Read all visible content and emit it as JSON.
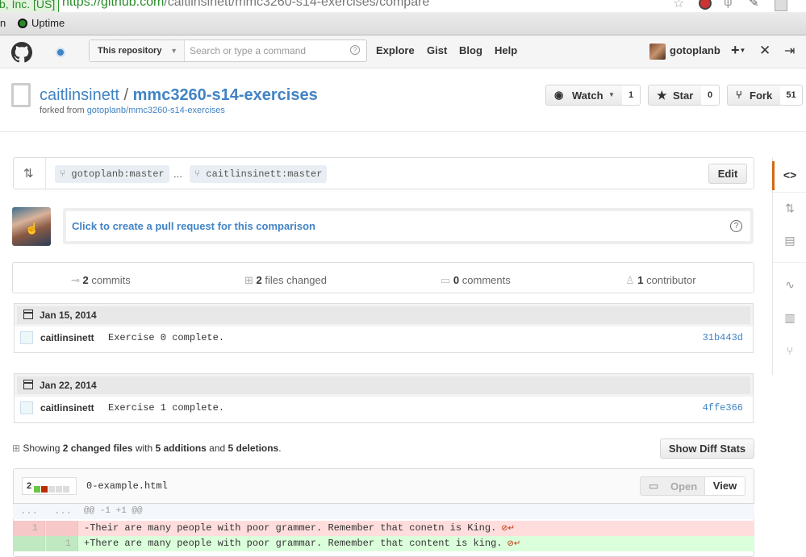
{
  "browser": {
    "ev_badge": "b, Inc. [US]",
    "url_host": "https://github.com",
    "url_path": "/caitlinsinett/mmc3260-s14-exercises/compare",
    "bookmarks": [
      "n",
      "Uptime"
    ]
  },
  "header": {
    "scope_label": "This repository",
    "search_placeholder": "Search or type a command",
    "nav": [
      "Explore",
      "Gist",
      "Blog",
      "Help"
    ],
    "username": "gotoplanb",
    "plus": "+"
  },
  "repo": {
    "owner": "caitlinsinett",
    "separator": "/",
    "name": "mmc3260-s14-exercises",
    "forked_prefix": "forked from ",
    "forked_from": "gotoplanb/mmc3260-s14-exercises",
    "watch_label": "Watch",
    "watch_count": "1",
    "star_label": "Star",
    "star_count": "0",
    "fork_label": "Fork",
    "fork_count": "51"
  },
  "compare": {
    "base": "gotoplanb:master",
    "dots": "...",
    "head": "caitlinsinett:master",
    "edit_label": "Edit",
    "pr_prompt": "Click to create a pull request for this comparison"
  },
  "stats": {
    "commits_num": "2",
    "commits_label": " commits",
    "files_num": "2",
    "files_label": " files changed",
    "comments_num": "0",
    "comments_label": " comments",
    "contributors_num": "1",
    "contributors_label": " contributor"
  },
  "commit_groups": [
    {
      "date": "Jan 15, 2014",
      "author": "caitlinsinett",
      "message": "Exercise 0 complete.",
      "sha": "31b443d"
    },
    {
      "date": "Jan 22, 2014",
      "author": "caitlinsinett",
      "message": "Exercise 1 complete.",
      "sha": "4ffe366"
    }
  ],
  "summary": {
    "prefix": "Showing ",
    "files": "2 changed files",
    "mid1": " with ",
    "additions": "5 additions",
    "mid2": " and ",
    "deletions": "5 deletions",
    "suffix": ".",
    "diffstats_button": "Show Diff Stats"
  },
  "file": {
    "change_count": "2",
    "name": "0-example.html",
    "open_label": "Open",
    "view_label": "View",
    "hunk_left": "...",
    "hunk_right": "...",
    "hunk_header": "@@ -1 +1 @@",
    "del_line_no": "1",
    "del_text": "-Their are many people with poor grammer. Remember that conetn is King.",
    "add_line_no": "1",
    "add_text": "+There are many people with poor grammar. Remember that content is king."
  },
  "colors": {
    "link": "#4183c4",
    "del_bg": "#ffdddd",
    "add_bg": "#dbffdb",
    "accent": "#d26911"
  }
}
